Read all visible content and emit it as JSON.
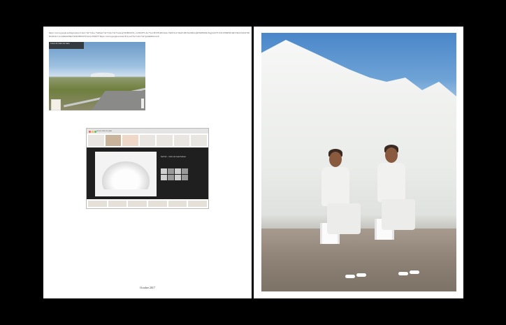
{
  "left_page": {
    "url_text": "https://www.google.es/maps/place/Cruce+de+Cabo,+Salinas+de+Cabo+de+Gata/@36.8061655,-2.2502975,3a,75y,139.97h,90t/data=!3m6!1e1!3m4!1sBvXxz0KGqfeFbbBJm6LXqg!2e0!7i13312!8i6656!4m5!3m4!1s0xd7068e4:0x2cc1a12d6d2a!8m2!3d36.8061655!4d-2.2502975 https://www.google.es/search?q=sal+de+cabo+de+gata&tbm=isch",
    "date": "October 2017",
    "street_view_label": "Cruce de Cabo de Gata",
    "browser_tab": "sal de cabo de gata",
    "preview_title": "Sal Flor – Cabo de Gata Salinas"
  },
  "right_page": {
    "photo_subject": "salt-mountain-with-two-seated-figures-photo"
  },
  "colors": {
    "background": "#000000",
    "page": "#ffffff",
    "sky": "#4a86c9",
    "salt": "#eceeec"
  }
}
